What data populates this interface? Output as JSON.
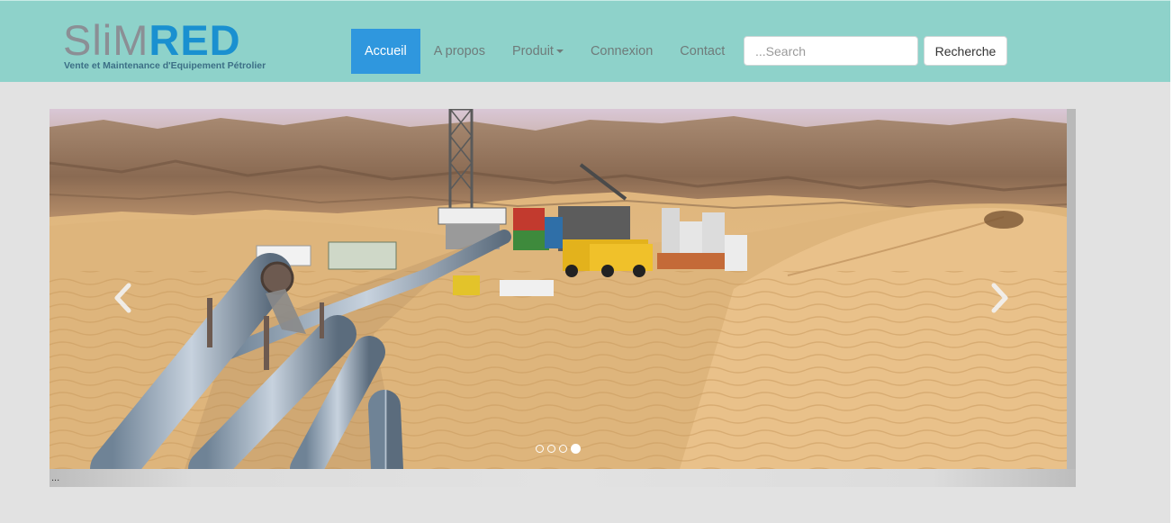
{
  "brand": {
    "logo_part1": "SliM",
    "logo_part2": "RED",
    "tagline": "Vente et Maintenance d'Equipement Pétrolier"
  },
  "nav": {
    "items": [
      {
        "label": "Accueil",
        "active": true
      },
      {
        "label": "A propos",
        "active": false
      },
      {
        "label": "Produit",
        "active": false,
        "dropdown": true
      },
      {
        "label": "Connexion",
        "active": false
      },
      {
        "label": "Contact",
        "active": false
      }
    ]
  },
  "search": {
    "placeholder": "...Search",
    "value": "",
    "button_label": "Recherche"
  },
  "carousel": {
    "slide_alt": "Oil drilling site with pipelines in the desert",
    "caption": "...",
    "indicator_count": 4,
    "active_index": 3,
    "prev_icon": "chevron-left-icon",
    "next_icon": "chevron-right-icon"
  },
  "colors": {
    "header_bg": "#8ed2ca",
    "active_nav": "#2f97de",
    "logo_grey": "#8b8f95",
    "logo_blue": "#1a90d0",
    "page_bg": "#e2e2e2"
  }
}
